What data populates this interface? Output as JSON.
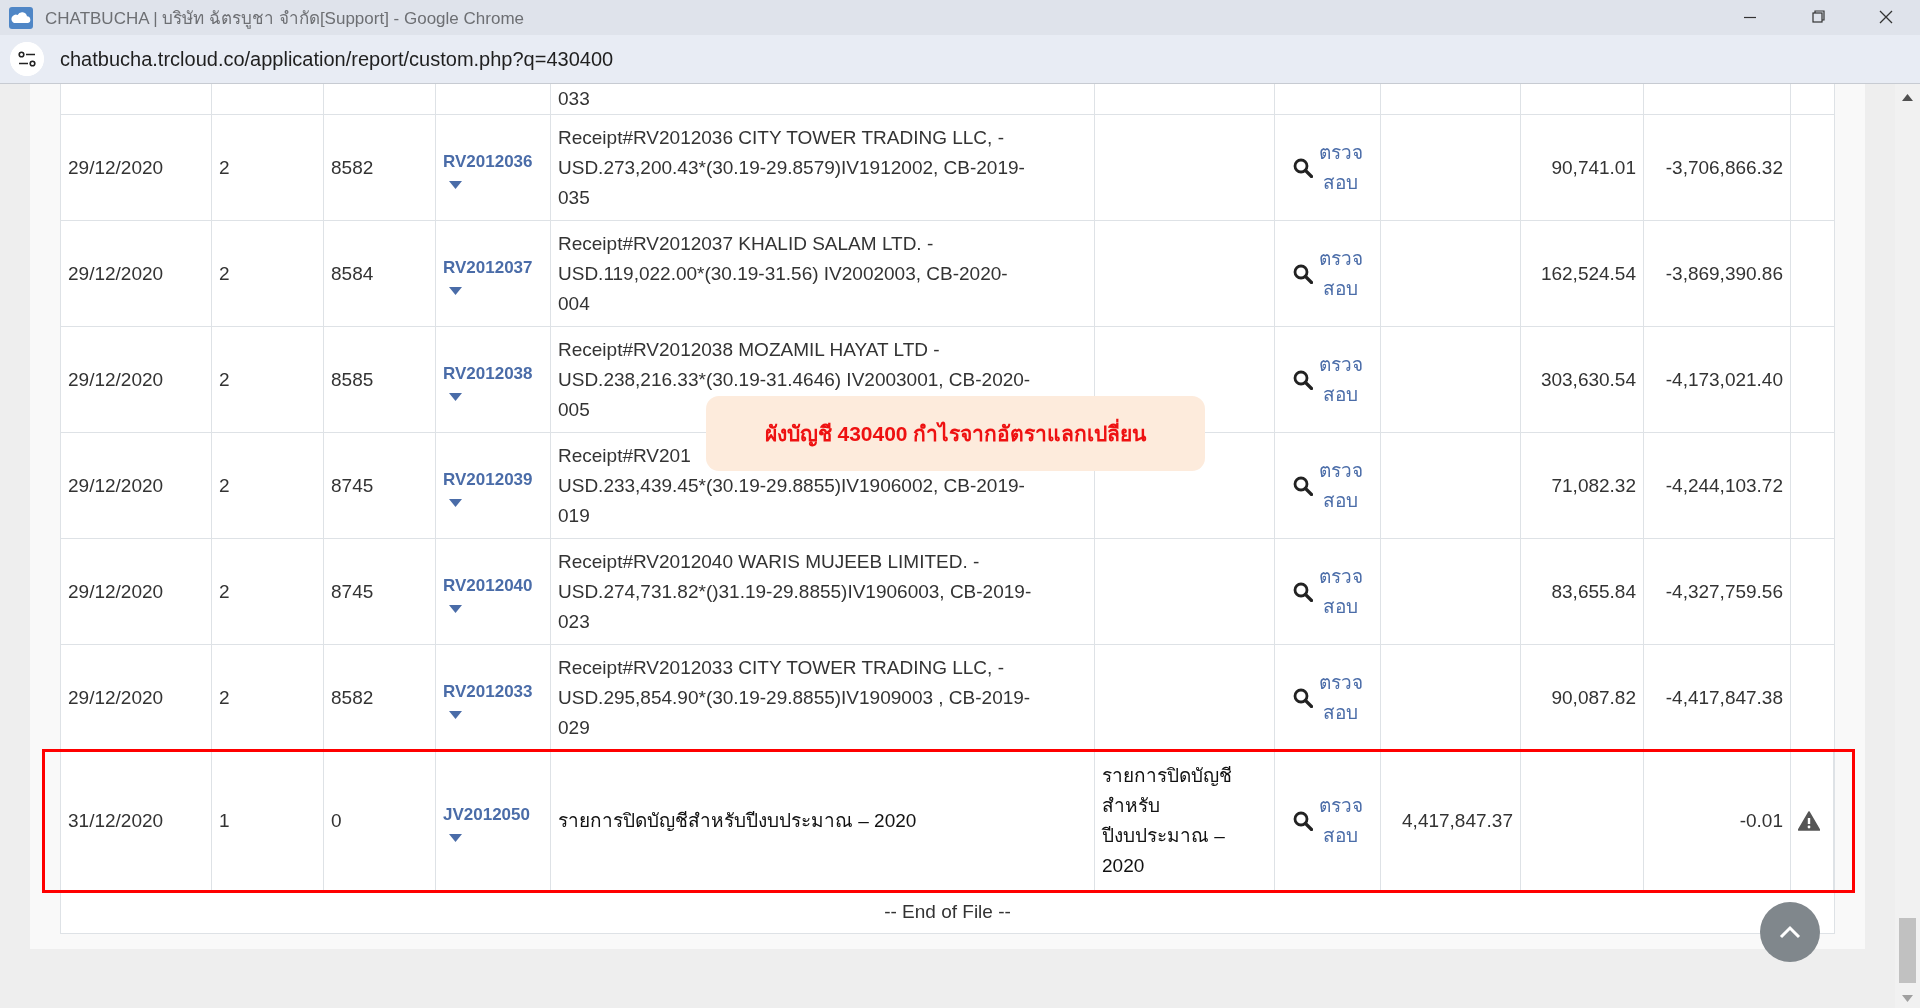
{
  "window": {
    "title": "CHATBUCHA | บริษัท ฉัตรบูชา จำกัด[Support] - Google Chrome"
  },
  "address_bar": {
    "url": "chatbucha.trcloud.co/application/report/custom.php?q=430400"
  },
  "callout": {
    "text": "ผังบัญชี 430400 กำไรจากอัตราแลกเปลี่ยน"
  },
  "table": {
    "rows": [
      {
        "kind": "partial",
        "column_5": "033",
        "warning": false,
        "highlighted": false
      },
      {
        "kind": "entry",
        "column_1": "29/12/2020",
        "column_2": "2",
        "column_3": "8582",
        "column_4": "RV2012036",
        "column_5": "Receipt#RV2012036 CITY TOWER TRADING LLC, -\nUSD.273,200.43*(30.19-29.8579)IV1912002, CB-2019-\n035",
        "column_7": "ตรวจ\nสอบ",
        "column_9": "90,741.01",
        "column_10": "-3,706,866.32",
        "warning": false,
        "highlighted": false
      },
      {
        "kind": "entry",
        "column_1": "29/12/2020",
        "column_2": "2",
        "column_3": "8584",
        "column_4": "RV2012037",
        "column_5": "Receipt#RV2012037 KHALID SALAM LTD. -\nUSD.119,022.00*(30.19-31.56) IV2002003, CB-2020-\n004",
        "column_7": "ตรวจ\nสอบ",
        "column_9": "162,524.54",
        "column_10": "-3,869,390.86",
        "warning": false,
        "highlighted": false
      },
      {
        "kind": "entry",
        "column_1": "29/12/2020",
        "column_2": "2",
        "column_3": "8585",
        "column_4": "RV2012038",
        "column_5": "Receipt#RV2012038 MOZAMIL HAYAT LTD -\nUSD.238,216.33*(30.19-31.4646) IV2003001, CB-2020-\n005",
        "column_7": "ตรวจ\nสอบ",
        "column_9": "303,630.54",
        "column_10": "-4,173,021.40",
        "warning": false,
        "highlighted": false
      },
      {
        "kind": "entry",
        "column_1": "29/12/2020",
        "column_2": "2",
        "column_3": "8745",
        "column_4": "RV2012039",
        "column_5": "Receipt#RV201\nUSD.233,439.45*(30.19-29.8855)IV1906002, CB-2019-\n019",
        "column_7": "ตรวจ\nสอบ",
        "column_9": "71,082.32",
        "column_10": "-4,244,103.72",
        "warning": false,
        "highlighted": false
      },
      {
        "kind": "entry",
        "column_1": "29/12/2020",
        "column_2": "2",
        "column_3": "8745",
        "column_4": "RV2012040",
        "column_5": "Receipt#RV2012040 WARIS MUJEEB LIMITED. -\nUSD.274,731.82*()31.19-29.8855)IV1906003, CB-2019-\n023",
        "column_7": "ตรวจ\nสอบ",
        "column_9": "83,655.84",
        "column_10": "-4,327,759.56",
        "warning": false,
        "highlighted": false
      },
      {
        "kind": "entry",
        "column_1": "29/12/2020",
        "column_2": "2",
        "column_3": "8582",
        "column_4": "RV2012033",
        "column_5": "Receipt#RV2012033 CITY TOWER TRADING LLC, -\nUSD.295,854.90*(30.19-29.8855)IV1909003 , CB-2019-\n029",
        "column_7": "ตรวจ\nสอบ",
        "column_9": "90,087.82",
        "column_10": "-4,417,847.38",
        "warning": false,
        "highlighted": false
      },
      {
        "kind": "entry",
        "column_1": "31/12/2020",
        "column_2": "1",
        "column_3": "0",
        "column_4": "JV2012050",
        "column_5": "รายการปิดบัญชีสำหรับปีงบประมาณ – 2020",
        "column_6": "รายการปิดบัญชี\nสำหรับ\nปีงบประมาณ –\n2020",
        "column_7": "ตรวจ\nสอบ",
        "column_8": "4,417,847.37",
        "column_10": "-0.01",
        "warning": true,
        "highlighted": true
      }
    ],
    "footer": "-- End of File --"
  }
}
